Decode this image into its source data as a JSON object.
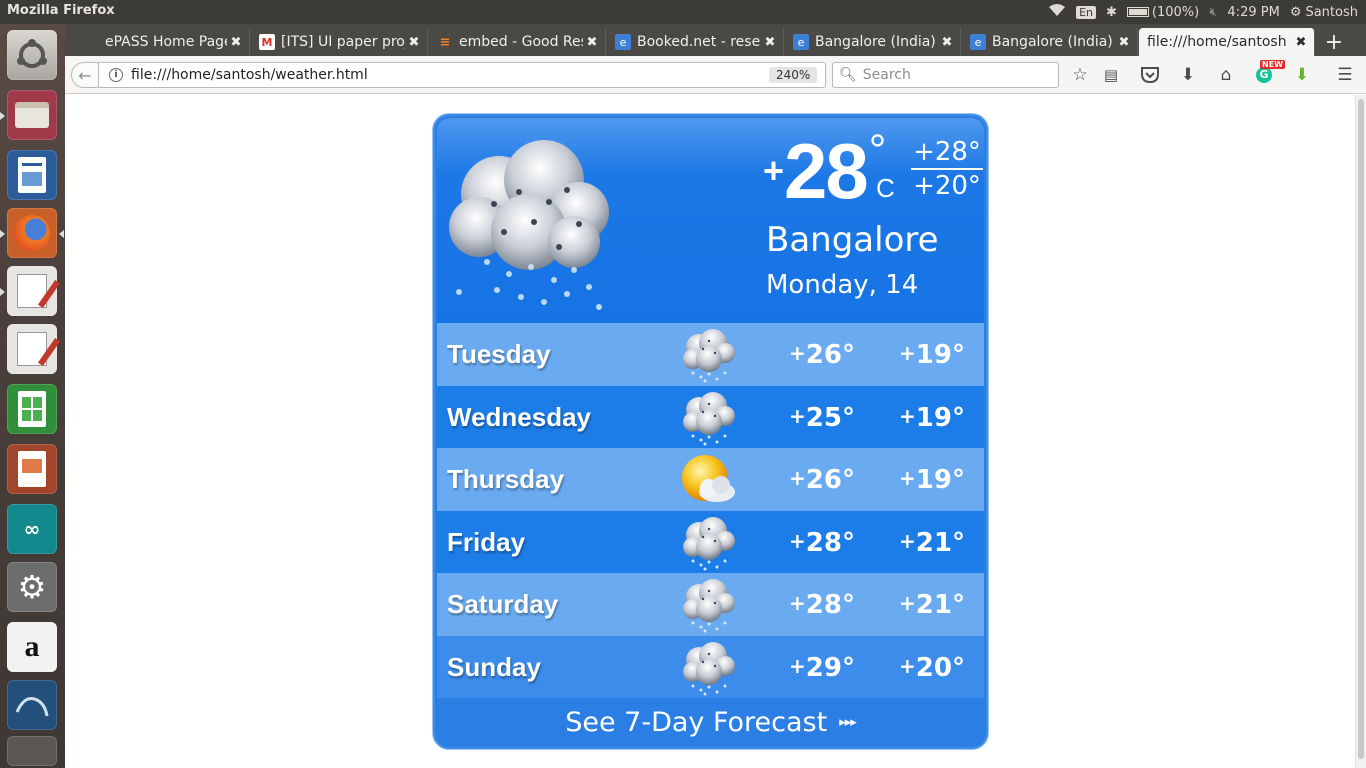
{
  "system": {
    "app_title": "Mozilla Firefox",
    "keyboard": "En",
    "battery": "(100%)",
    "time": "4:29 PM",
    "user": "Santosh"
  },
  "tabs": [
    {
      "label": "ePASS Home Page",
      "icon": "epass-icon",
      "icon_color": "#4a4945"
    },
    {
      "label": "[ITS] UI paper proj",
      "icon": "gmail-icon",
      "icon_color": "#d93025"
    },
    {
      "label": "embed - Good Res",
      "icon": "stackoverflow-icon",
      "icon_color": "#f48024"
    },
    {
      "label": "Booked.net - reser",
      "icon": "booked-icon",
      "icon_color": "#3d7fd4"
    },
    {
      "label": "Bangalore (India)",
      "icon": "booked-icon",
      "icon_color": "#3d7fd4"
    },
    {
      "label": "Bangalore (India)",
      "icon": "booked-icon",
      "icon_color": "#3d7fd4"
    },
    {
      "label": "file:///home/santosh",
      "icon": "file-icon",
      "icon_color": "#ffffff"
    }
  ],
  "navbar": {
    "url": "file:///home/santosh/weather.html",
    "zoom": "240%",
    "search_placeholder": "Search",
    "addon_badge": "NEW"
  },
  "weather": {
    "current": {
      "sign": "+",
      "temp": "28",
      "degree": "°",
      "unit": "C",
      "high": "+28°",
      "low": "+20°",
      "city": "Bangalore",
      "date": "Monday, 14",
      "icon": "rain-cloud-icon"
    },
    "forecast": [
      {
        "day": "Tuesday",
        "icon": "rain-cloud-icon",
        "hi": "26°",
        "lo": "19°"
      },
      {
        "day": "Wednesday",
        "icon": "rain-cloud-icon",
        "hi": "25°",
        "lo": "19°"
      },
      {
        "day": "Thursday",
        "icon": "sun-cloud-icon",
        "hi": "26°",
        "lo": "19°"
      },
      {
        "day": "Friday",
        "icon": "rain-cloud-icon",
        "hi": "28°",
        "lo": "21°"
      },
      {
        "day": "Saturday",
        "icon": "rain-cloud-icon",
        "hi": "28°",
        "lo": "21°"
      },
      {
        "day": "Sunday",
        "icon": "rain-cloud-icon",
        "hi": "29°",
        "lo": "20°"
      }
    ],
    "plus": "+",
    "forecast_link": "See 7-Day Forecast",
    "forecast_arrow": "▸▸▸"
  },
  "colors": {
    "widget_blue": "#1673e4",
    "row_light": "#6aaaf0",
    "row_dark": "#1d7de8"
  }
}
